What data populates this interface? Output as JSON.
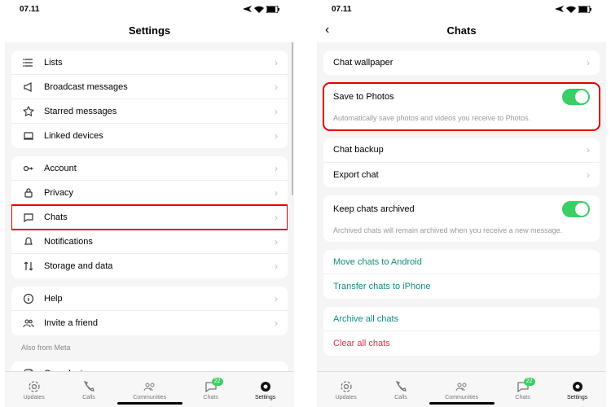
{
  "status": {
    "time": "07.11"
  },
  "left": {
    "title": "Settings",
    "g1": [
      {
        "icon": "list",
        "label": "Lists"
      },
      {
        "icon": "megaphone",
        "label": "Broadcast messages"
      },
      {
        "icon": "star",
        "label": "Starred messages"
      },
      {
        "icon": "laptop",
        "label": "Linked devices"
      }
    ],
    "g2": [
      {
        "icon": "key",
        "label": "Account"
      },
      {
        "icon": "lock",
        "label": "Privacy"
      },
      {
        "icon": "chat",
        "label": "Chats",
        "hl": true
      },
      {
        "icon": "bell",
        "label": "Notifications"
      },
      {
        "icon": "arrows",
        "label": "Storage and data"
      }
    ],
    "g3": [
      {
        "icon": "info",
        "label": "Help"
      },
      {
        "icon": "people",
        "label": "Invite a friend"
      }
    ],
    "also_label": "Also from Meta",
    "g4": [
      {
        "icon": "instagram",
        "label": "Open Instagram"
      }
    ]
  },
  "right": {
    "title": "Chats",
    "wallpaper": "Chat wallpaper",
    "save": {
      "label": "Save to Photos",
      "desc": "Automatically save photos and videos you receive to Photos."
    },
    "backup": "Chat backup",
    "export": "Export chat",
    "keep": {
      "label": "Keep chats archived",
      "desc": "Archived chats will remain archived when you receive a new message."
    },
    "move_android": "Move chats to Android",
    "transfer_iphone": "Transfer chats to iPhone",
    "archive_all": "Archive all chats",
    "clear_all": "Clear all chats"
  },
  "tabs": {
    "updates": "Updates",
    "calls": "Calls",
    "communities": "Communities",
    "chats": "Chats",
    "settings": "Settings",
    "badge": "22"
  }
}
